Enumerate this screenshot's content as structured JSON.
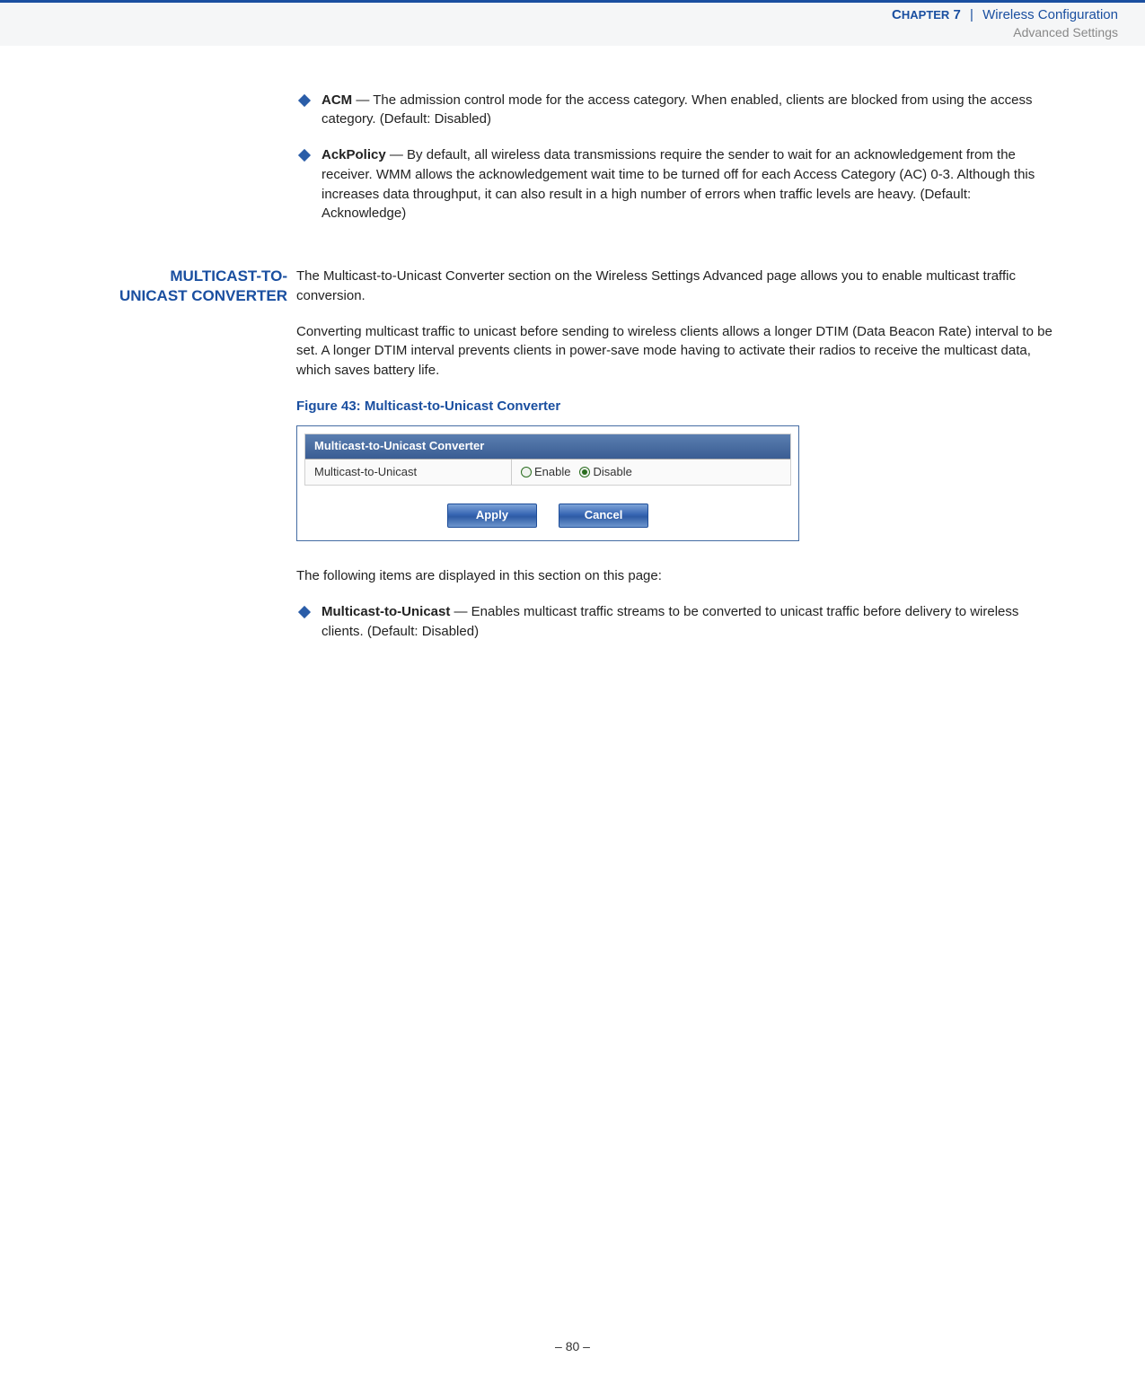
{
  "header": {
    "chapter_prefix": "C",
    "chapter_rest": "HAPTER",
    "chapter_num": "7",
    "sep": "|",
    "trail": "Wireless Configuration",
    "sub": "Advanced Settings"
  },
  "bullets_top": [
    {
      "term": "ACM",
      "desc": " — The admission control mode for the access category. When enabled, clients are blocked from using the access category. (Default: Disabled)"
    },
    {
      "term": "AckPolicy",
      "desc": " — By default, all wireless data transmissions require the sender to wait for an acknowledgement from the receiver. WMM allows the acknowledgement wait time to be turned off for each Access Category (AC) 0-3. Although this increases data throughput, it can also result in a high number of errors when traffic levels are heavy. (Default: Acknowledge)"
    }
  ],
  "side_heading_line1": "MULTICAST-TO-",
  "side_heading_line2": "UNICAST CONVERTER",
  "section_intro": "The Multicast-to-Unicast Converter section on the Wireless Settings Advanced page allows you to enable multicast traffic conversion.",
  "section_para2": "Converting multicast traffic to unicast before sending to wireless clients allows a longer DTIM (Data Beacon Rate) interval to be set. A longer DTIM interval prevents clients in power-save mode having to activate their radios to receive the multicast data, which saves battery life.",
  "figure_caption": "Figure 43:  Multicast-to-Unicast Converter",
  "panel": {
    "title": "Multicast-to-Unicast Converter",
    "row_label": "Multicast-to-Unicast",
    "enable_label": "Enable",
    "disable_label": "Disable",
    "selected": "disable",
    "apply": "Apply",
    "cancel": "Cancel"
  },
  "after_panel_intro": "The following items are displayed in this section on this page:",
  "bullets_bottom": [
    {
      "term": "Multicast-to-Unicast",
      "desc": " — Enables multicast traffic streams to be converted to unicast traffic before delivery to wireless clients. (Default: Disabled)"
    }
  ],
  "footer": "–  80  –"
}
